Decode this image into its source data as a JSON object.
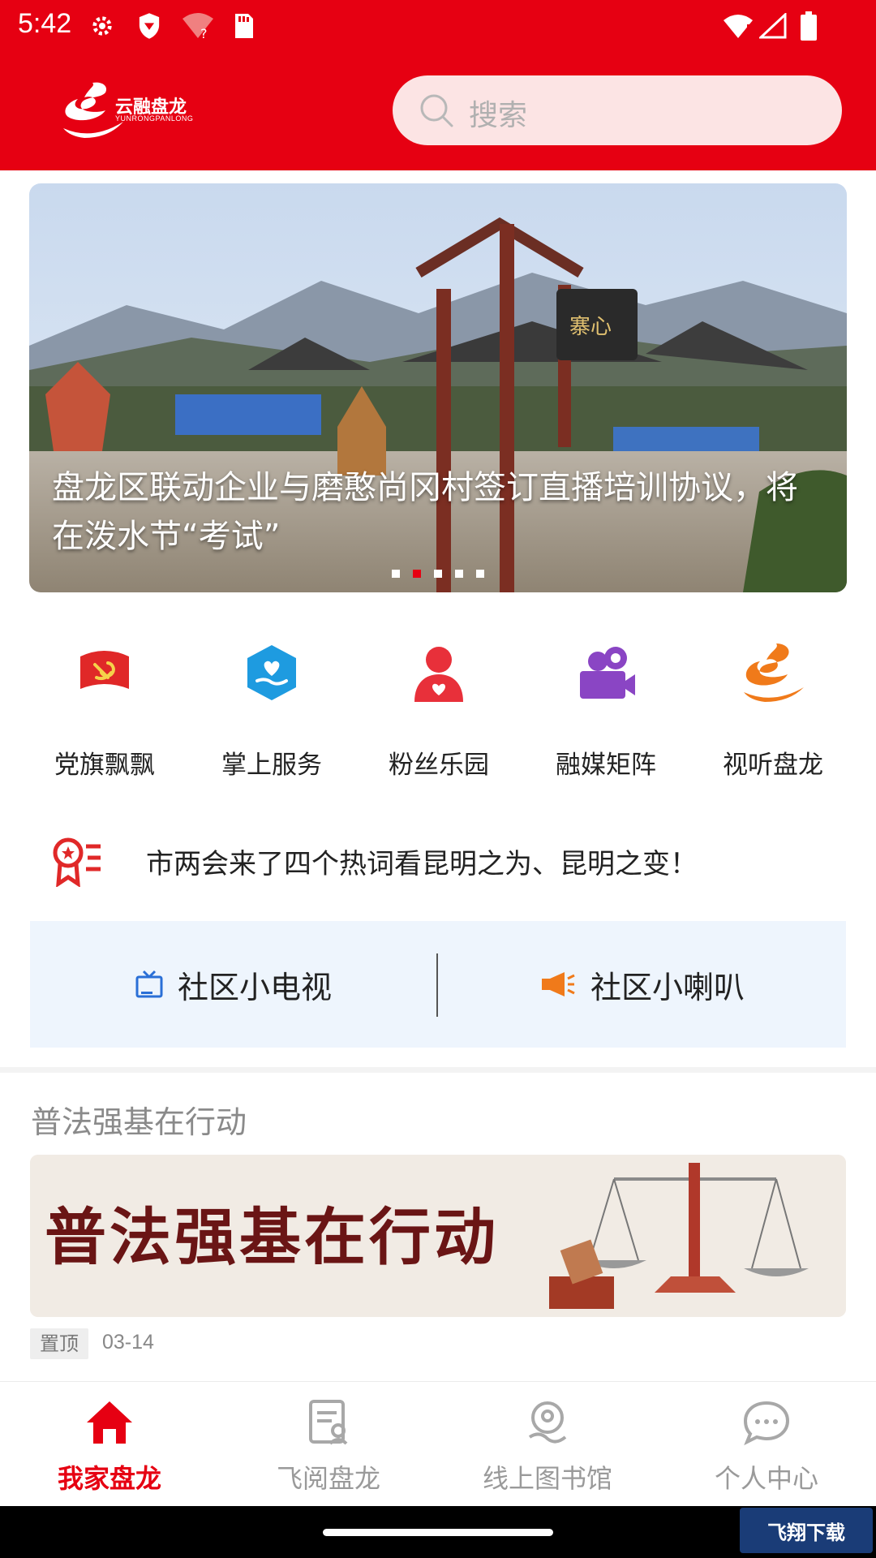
{
  "status_bar": {
    "time": "5:42"
  },
  "header": {
    "logo_text": "云融盘龙",
    "logo_sub": "YUNRONGPANLONG",
    "search_placeholder": "搜索"
  },
  "banner": {
    "caption": "盘龙区联动企业与磨憨尚冈村签订直播培训协议，将在泼水节“考试”",
    "sign_text": "寨心",
    "dot_count": 5,
    "active_dot": 2
  },
  "grid": {
    "items": [
      {
        "label": "党旗飘飘",
        "icon": "party-flag-icon"
      },
      {
        "label": "掌上服务",
        "icon": "hand-heart-icon"
      },
      {
        "label": "粉丝乐园",
        "icon": "fan-person-icon"
      },
      {
        "label": "融媒矩阵",
        "icon": "video-camera-icon"
      },
      {
        "label": "视听盘龙",
        "icon": "dragon-icon"
      }
    ]
  },
  "headline": {
    "text": "市两会来了四个热词看昆明之为、昆明之变！",
    "icon": "award-list-icon"
  },
  "community": {
    "items": [
      {
        "label": "社区小电视",
        "icon": "tv-icon"
      },
      {
        "label": "社区小喇叭",
        "icon": "megaphone-icon"
      }
    ]
  },
  "section": {
    "title": "普法强基在行动",
    "image_title": "普法强基在行动",
    "badge": "置顶",
    "date": "03-14"
  },
  "bottom_nav": {
    "items": [
      {
        "label": "我家盘龙",
        "icon": "home-icon",
        "active": true
      },
      {
        "label": "飞阅盘龙",
        "icon": "document-icon",
        "active": false
      },
      {
        "label": "线上图书馆",
        "icon": "library-icon",
        "active": false
      },
      {
        "label": "个人中心",
        "icon": "chat-icon",
        "active": false
      }
    ]
  },
  "watermark": "飞翔下载",
  "colors": {
    "brand_red": "#e60012",
    "community_bg": "#eef5fd"
  }
}
